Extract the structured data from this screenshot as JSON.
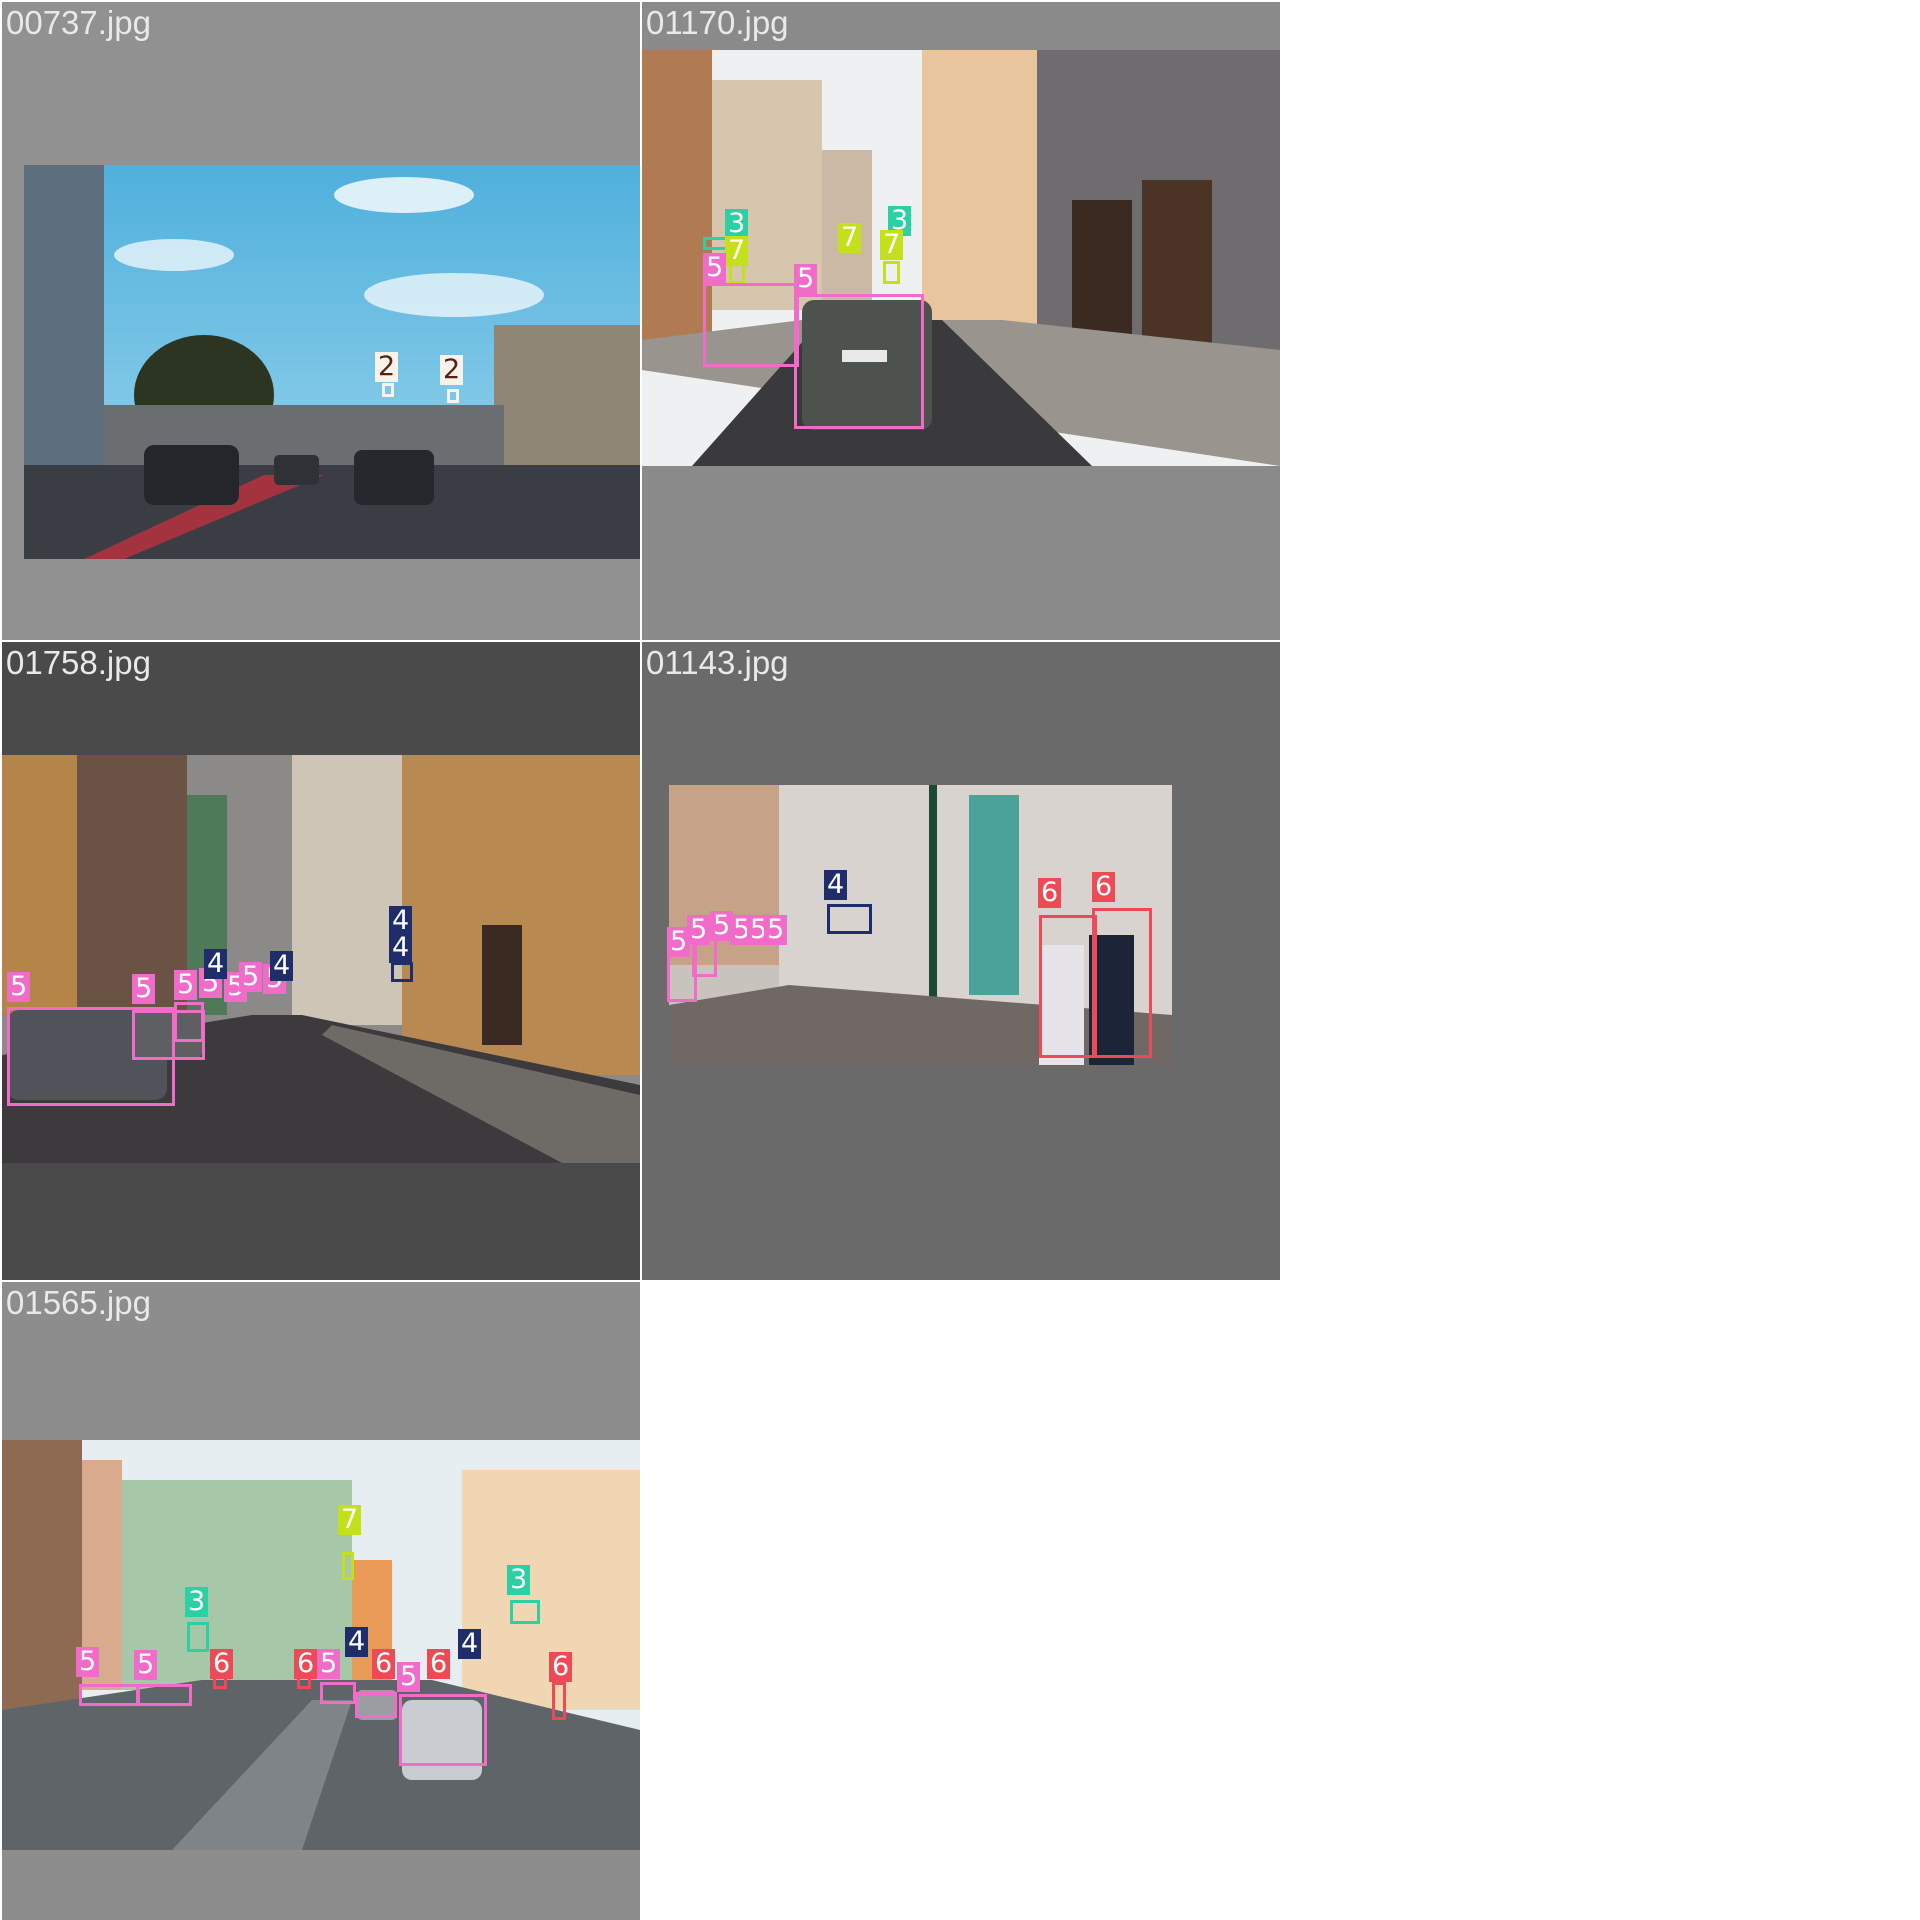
{
  "tiles": [
    {
      "name": "00737.jpg",
      "labels": [
        "2",
        "2"
      ]
    },
    {
      "name": "01170.jpg",
      "labels": [
        "3",
        "3",
        "7",
        "7",
        "7",
        "5",
        "5"
      ]
    },
    {
      "name": "01758.jpg",
      "labels": [
        "5",
        "5",
        "5",
        "5",
        "5",
        "5",
        "5",
        "4",
        "4",
        "4",
        "4"
      ]
    },
    {
      "name": "01143.jpg",
      "labels": [
        "5",
        "5",
        "5",
        "5",
        "5",
        "5",
        "4",
        "6",
        "6"
      ]
    },
    {
      "name": "01565.jpg",
      "labels": [
        "5",
        "5",
        "3",
        "7",
        "3",
        "6",
        "6",
        "5",
        "4",
        "6",
        "5",
        "6",
        "4",
        "6"
      ]
    }
  ],
  "class_colors": {
    "2": "#f7f2ea",
    "3": "#2bd1a5",
    "4": "#1f2d6b",
    "5": "#f06cc8",
    "6": "#ee4a55",
    "7": "#c4e01a"
  }
}
